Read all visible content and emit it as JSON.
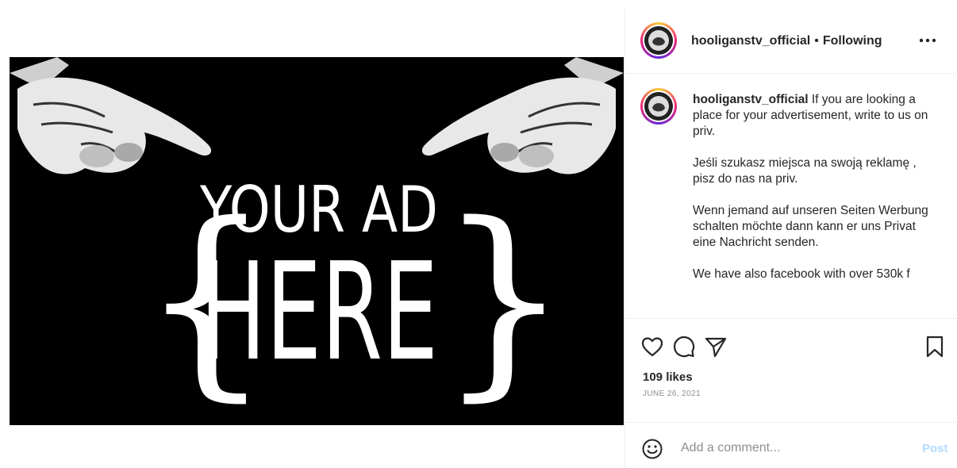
{
  "post": {
    "image": {
      "line1": "YOUR AD",
      "line2": "HERE",
      "background": "#000000",
      "text_color": "#ffffff"
    }
  },
  "header": {
    "username": "hooliganstv_official",
    "separator": "•",
    "follow_status": "Following",
    "more_icon": "more-horizontal-icon"
  },
  "caption": {
    "username": "hooliganstv_official",
    "paragraph1": "If you are looking a place for your advertisement, write to us on priv.",
    "paragraph2": "Jeśli szukasz miejsca na swoją reklamę , pisz do nas na priv.",
    "paragraph3": "Wenn jemand auf unseren Seiten Werbung schalten möchte dann kann er uns Privat eine Nachricht senden.",
    "paragraph4": "We have also facebook with over 530k f"
  },
  "actions": {
    "like_icon": "heart-icon",
    "comment_icon": "comment-icon",
    "share_icon": "paper-plane-icon",
    "save_icon": "bookmark-icon",
    "likes": "109 likes",
    "date": "JUNE 26, 2021"
  },
  "comment": {
    "emoji_icon": "smiley-icon",
    "placeholder": "Add a comment...",
    "post_label": "Post"
  },
  "colors": {
    "accent_disabled": "#b3dbff",
    "muted": "#8e8e8e",
    "text": "#262626"
  }
}
